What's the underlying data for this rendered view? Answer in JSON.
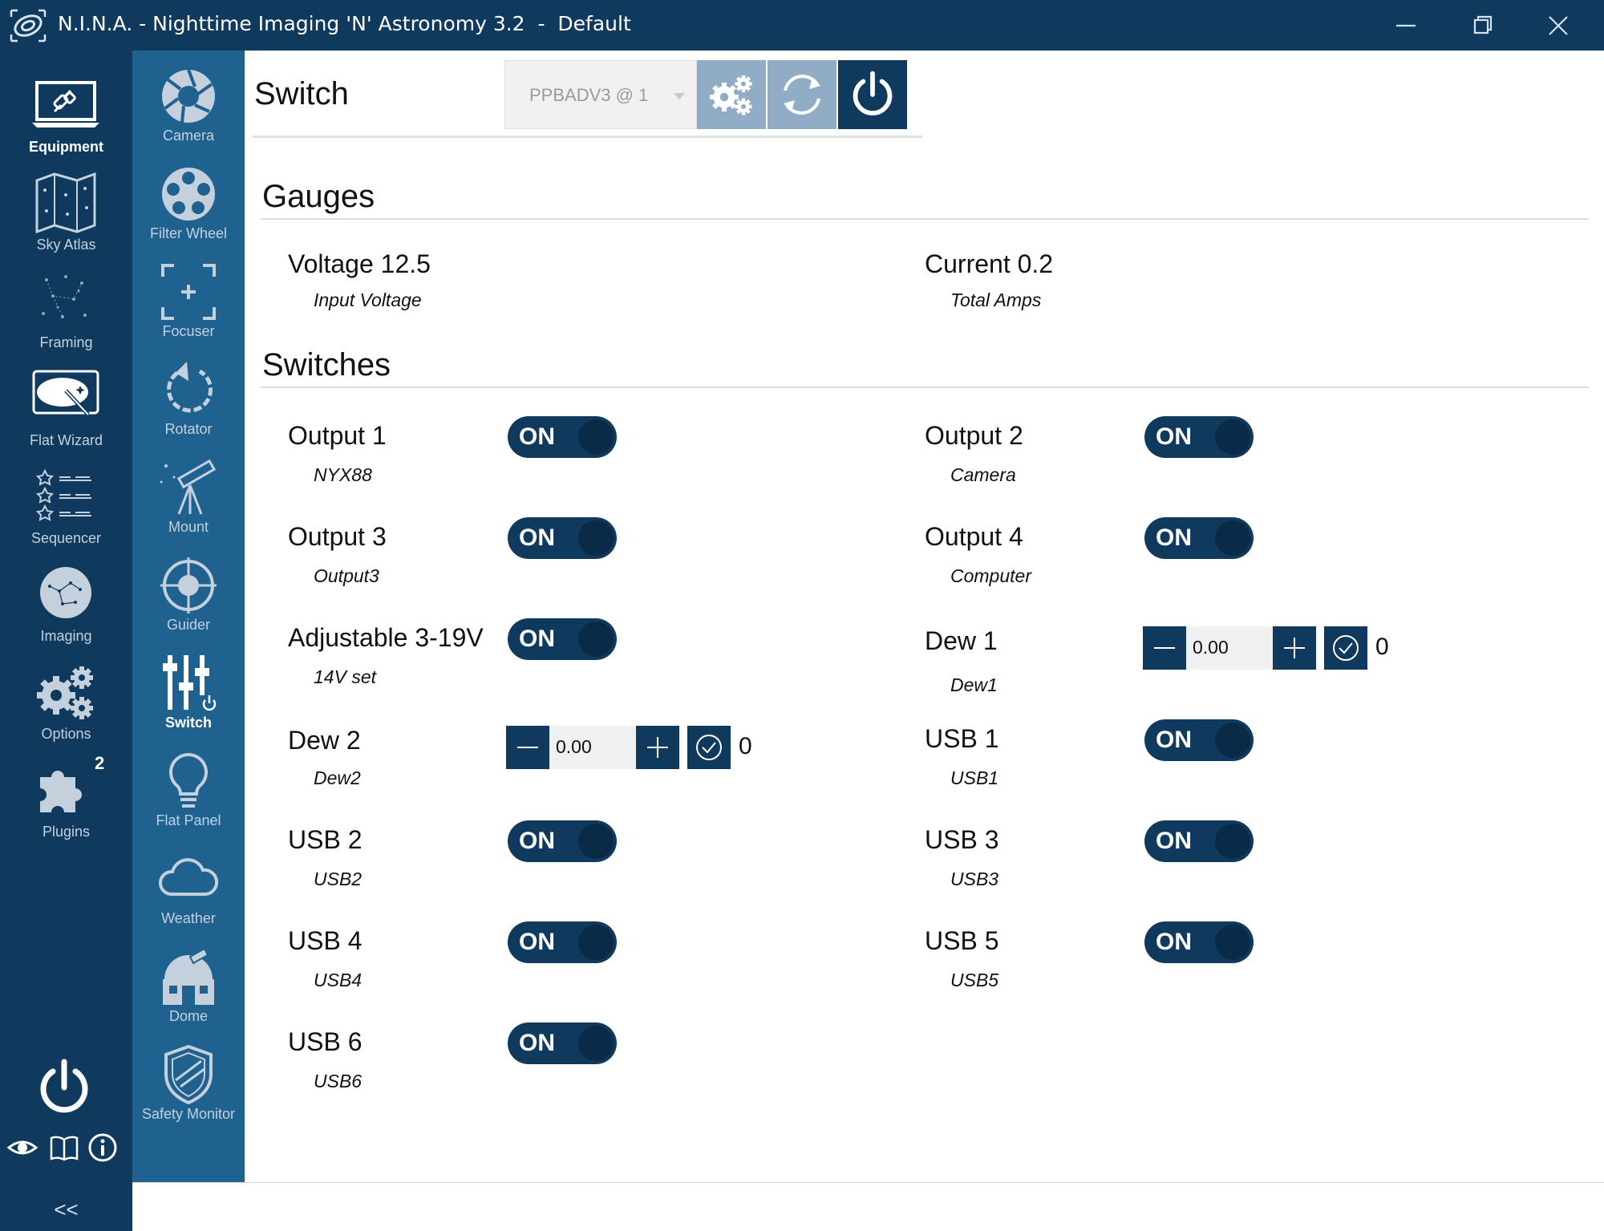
{
  "window": {
    "title": "N.I.N.A. - Nighttime Imaging 'N' Astronomy 3.2  -  Default",
    "controls": [
      "minimize",
      "restore",
      "close"
    ]
  },
  "nav": {
    "items": [
      {
        "label": "Equipment",
        "icon": "equipment-icon",
        "active": true
      },
      {
        "label": "Sky Atlas",
        "icon": "sky-atlas-icon"
      },
      {
        "label": "Framing",
        "icon": "framing-icon"
      },
      {
        "label": "Flat Wizard",
        "icon": "flat-wizard-icon"
      },
      {
        "label": "Sequencer",
        "icon": "sequencer-icon"
      },
      {
        "label": "Imaging",
        "icon": "imaging-icon"
      },
      {
        "label": "Options",
        "icon": "options-icon"
      },
      {
        "label": "Plugins",
        "icon": "plugins-icon",
        "badge": "2"
      }
    ],
    "collapse_label": "<<"
  },
  "subnav": {
    "items": [
      {
        "label": "Camera",
        "icon": "camera-icon"
      },
      {
        "label": "Filter Wheel",
        "icon": "filter-wheel-icon"
      },
      {
        "label": "Focuser",
        "icon": "focuser-icon"
      },
      {
        "label": "Rotator",
        "icon": "rotator-icon"
      },
      {
        "label": "Mount",
        "icon": "mount-icon"
      },
      {
        "label": "Guider",
        "icon": "guider-icon"
      },
      {
        "label": "Switch",
        "icon": "switch-icon",
        "active": true
      },
      {
        "label": "Flat Panel",
        "icon": "flat-panel-icon"
      },
      {
        "label": "Weather",
        "icon": "weather-icon"
      },
      {
        "label": "Dome",
        "icon": "dome-icon"
      },
      {
        "label": "Safety Monitor",
        "icon": "safety-monitor-icon"
      }
    ]
  },
  "header": {
    "title": "Switch",
    "device": "PPBADV3 @ 1"
  },
  "gauges": {
    "title": "Gauges",
    "items": [
      {
        "name": "Voltage 12.5",
        "desc": "Input Voltage"
      },
      {
        "name": "Current 0.2",
        "desc": "Total Amps"
      }
    ]
  },
  "switches": {
    "title": "Switches",
    "items": [
      {
        "name": "Output 1",
        "desc": "NYX88",
        "type": "toggle",
        "state": "ON"
      },
      {
        "name": "Output 2",
        "desc": "Camera",
        "type": "toggle",
        "state": "ON"
      },
      {
        "name": "Output 3",
        "desc": "Output3",
        "type": "toggle",
        "state": "ON"
      },
      {
        "name": "Output 4",
        "desc": "Computer",
        "type": "toggle",
        "state": "ON"
      },
      {
        "name": "Adjustable 3-19V",
        "desc": "14V set",
        "type": "toggle",
        "state": "ON"
      },
      {
        "name": "Dew 1",
        "desc": "Dew1",
        "type": "stepper",
        "value": "0.00",
        "current": "0"
      },
      {
        "name": "Dew 2",
        "desc": "Dew2",
        "type": "stepper",
        "value": "0.00",
        "current": "0"
      },
      {
        "name": "USB 1",
        "desc": "USB1",
        "type": "toggle",
        "state": "ON"
      },
      {
        "name": "USB 2",
        "desc": "USB2",
        "type": "toggle",
        "state": "ON"
      },
      {
        "name": "USB 3",
        "desc": "USB3",
        "type": "toggle",
        "state": "ON"
      },
      {
        "name": "USB 4",
        "desc": "USB4",
        "type": "toggle",
        "state": "ON"
      },
      {
        "name": "USB 5",
        "desc": "USB5",
        "type": "toggle",
        "state": "ON"
      },
      {
        "name": "USB 6",
        "desc": "USB6",
        "type": "toggle",
        "state": "ON"
      }
    ]
  },
  "colors": {
    "nav_bg": "#0f3a5e",
    "subnav_bg": "#20628f",
    "accent": "#0f3a5e",
    "button_light": "#91adc6"
  }
}
